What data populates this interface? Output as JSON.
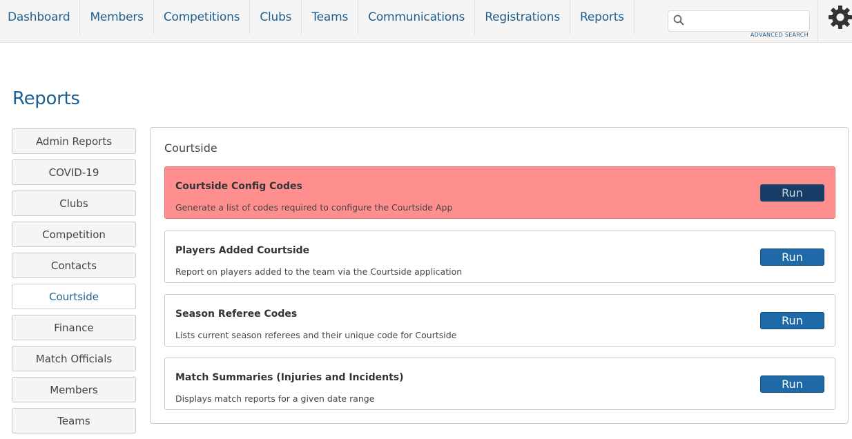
{
  "nav": {
    "items": [
      {
        "label": "Dashboard"
      },
      {
        "label": "Members"
      },
      {
        "label": "Competitions"
      },
      {
        "label": "Clubs"
      },
      {
        "label": "Teams"
      },
      {
        "label": "Communications"
      },
      {
        "label": "Registrations"
      },
      {
        "label": "Reports"
      }
    ],
    "search": {
      "value": "",
      "placeholder": "",
      "advanced_label": "ADVANCED SEARCH"
    },
    "settings_icon": "gear-icon"
  },
  "page": {
    "title": "Reports"
  },
  "sidebar": {
    "items": [
      {
        "label": "Admin Reports",
        "active": false
      },
      {
        "label": "COVID-19",
        "active": false
      },
      {
        "label": "Clubs",
        "active": false
      },
      {
        "label": "Competition",
        "active": false
      },
      {
        "label": "Contacts",
        "active": false
      },
      {
        "label": "Courtside",
        "active": true
      },
      {
        "label": "Finance",
        "active": false
      },
      {
        "label": "Match Officials",
        "active": false
      },
      {
        "label": "Members",
        "active": false
      },
      {
        "label": "Teams",
        "active": false
      }
    ]
  },
  "panel": {
    "title": "Courtside",
    "reports": [
      {
        "title": "Courtside Config Codes",
        "description": "Generate a list of codes required to configure the Courtside App",
        "run_label": "Run",
        "highlighted": true
      },
      {
        "title": "Players Added Courtside",
        "description": "Report on players added to the team via the Courtside application",
        "run_label": "Run",
        "highlighted": false
      },
      {
        "title": "Season Referee Codes",
        "description": "Lists current season referees and their unique code for Courtside",
        "run_label": "Run",
        "highlighted": false
      },
      {
        "title": "Match Summaries (Injuries and Incidents)",
        "description": "Displays match reports for a given date range",
        "run_label": "Run",
        "highlighted": false
      }
    ]
  },
  "colors": {
    "brand": "#1f5f8f",
    "run_button": "#1e6aa8",
    "highlight": "#ff8f8f"
  }
}
